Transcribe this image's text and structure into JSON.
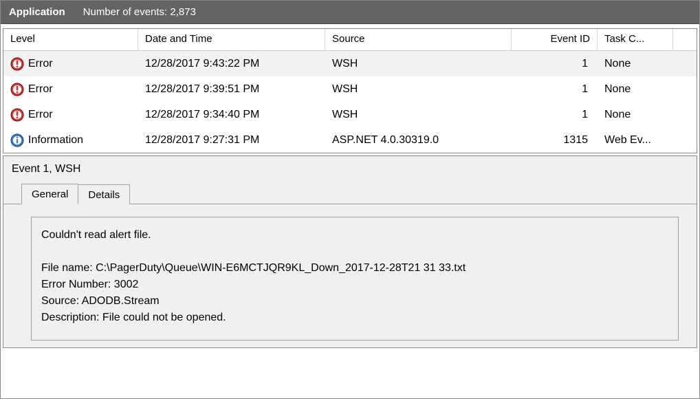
{
  "titlebar": {
    "app_label": "Application",
    "count_label": "Number of events: 2,873"
  },
  "columns": {
    "level": "Level",
    "date": "Date and Time",
    "source": "Source",
    "event_id": "Event ID",
    "task": "Task C..."
  },
  "rows": [
    {
      "icon": "error",
      "level": "Error",
      "date": "12/28/2017 9:43:22 PM",
      "source": "WSH",
      "event_id": "1",
      "task": "None",
      "selected": true
    },
    {
      "icon": "error",
      "level": "Error",
      "date": "12/28/2017 9:39:51 PM",
      "source": "WSH",
      "event_id": "1",
      "task": "None",
      "selected": false
    },
    {
      "icon": "error",
      "level": "Error",
      "date": "12/28/2017 9:34:40 PM",
      "source": "WSH",
      "event_id": "1",
      "task": "None",
      "selected": false
    },
    {
      "icon": "info",
      "level": "Information",
      "date": "12/28/2017 9:27:31 PM",
      "source": "ASP.NET 4.0.30319.0",
      "event_id": "1315",
      "task": "Web Ev...",
      "selected": false
    }
  ],
  "detail": {
    "title": "Event 1, WSH",
    "tabs": {
      "general": "General",
      "details": "Details"
    },
    "message": {
      "line1": "Couldn't read alert file.",
      "blank": "",
      "line2": "File name: C:\\PagerDuty\\Queue\\WIN-E6MCTJQR9KL_Down_2017-12-28T21 31 33.txt",
      "line3": "Error Number: 3002",
      "line4": "Source: ADODB.Stream",
      "line5": "Description: File could not be opened."
    }
  }
}
